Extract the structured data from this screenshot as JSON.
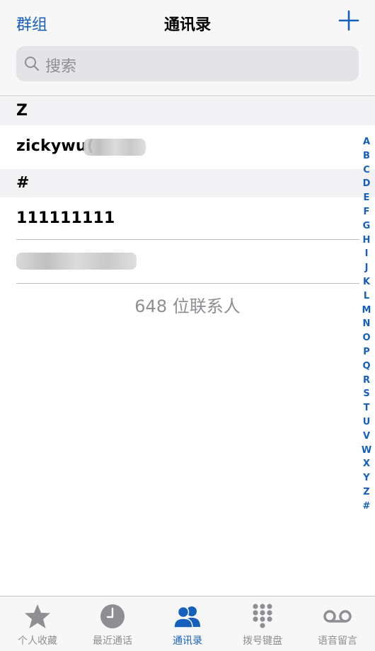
{
  "header": {
    "groups_label": "群组",
    "title": "通讯录",
    "add_icon": "plus-icon"
  },
  "search": {
    "placeholder": "搜索",
    "icon": "search-icon"
  },
  "sections": [
    {
      "header": "Z",
      "contacts": [
        {
          "name": "zickywu("
        }
      ]
    },
    {
      "header": "#",
      "contacts": [
        {
          "name": "111111111"
        },
        {
          "name": ""
        }
      ]
    }
  ],
  "contact_count": "648 位联系人",
  "index_letters": [
    "A",
    "B",
    "C",
    "D",
    "E",
    "F",
    "G",
    "H",
    "I",
    "J",
    "K",
    "L",
    "M",
    "N",
    "O",
    "P",
    "Q",
    "R",
    "S",
    "T",
    "U",
    "V",
    "W",
    "X",
    "Y",
    "Z",
    "#"
  ],
  "tab_bar": {
    "tabs": [
      {
        "label": "个人收藏",
        "icon": "star-icon",
        "active": false
      },
      {
        "label": "最近通话",
        "icon": "clock-icon",
        "active": false
      },
      {
        "label": "通讯录",
        "icon": "contacts-icon",
        "active": true
      },
      {
        "label": "拨号键盘",
        "icon": "keypad-icon",
        "active": false
      },
      {
        "label": "语音留言",
        "icon": "voicemail-icon",
        "active": false
      }
    ]
  },
  "colors": {
    "accent": "#1560bd",
    "inactive": "#8e8e93",
    "section_bg": "#f2f2f4"
  }
}
